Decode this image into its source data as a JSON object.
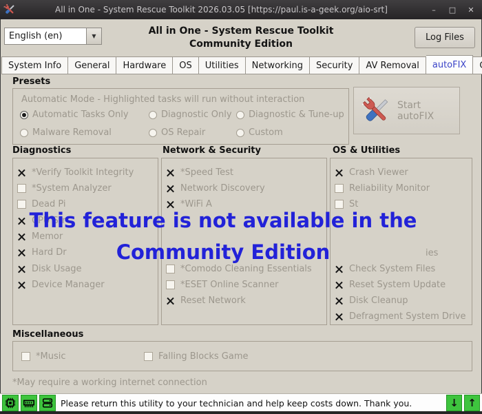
{
  "window": {
    "title": "All in One - System Rescue Toolkit 2026.03.05 [https://paul.is-a-geek.org/aio-srt]",
    "controls": {
      "minimize": "–",
      "maximize": "□",
      "close": "✕"
    }
  },
  "header": {
    "language_selected": "English (en)",
    "title_line1": "All in One - System Rescue Toolkit",
    "title_line2": "Community Edition",
    "log_files_button": "Log Files"
  },
  "tabs": {
    "active": "autoFIX",
    "items": [
      {
        "label": "System Info"
      },
      {
        "label": "General"
      },
      {
        "label": "Hardware"
      },
      {
        "label": "OS"
      },
      {
        "label": "Utilities"
      },
      {
        "label": "Networking"
      },
      {
        "label": "Security"
      },
      {
        "label": "AV Removal"
      },
      {
        "label": "autoFIX"
      },
      {
        "label": "Customize"
      }
    ]
  },
  "presets": {
    "heading": "Presets",
    "mode_text": "Automatic Mode - Highlighted tasks will run without interaction",
    "options": [
      {
        "label": "Automatic Tasks Only",
        "selected": true
      },
      {
        "label": "Diagnostic Only",
        "selected": false
      },
      {
        "label": "Diagnostic & Tune-up",
        "selected": false
      },
      {
        "label": "Malware Removal",
        "selected": false
      },
      {
        "label": "OS Repair",
        "selected": false
      },
      {
        "label": "Custom",
        "selected": false
      }
    ],
    "start_button": "Start autoFIX"
  },
  "columns": [
    {
      "title": "Diagnostics",
      "items": [
        {
          "checked": true,
          "label": "*Verify Toolkit Integrity"
        },
        {
          "checked": false,
          "label": "*System Analyzer"
        },
        {
          "checked": false,
          "label": "Dead Pi"
        },
        {
          "checked": true,
          "label": "CPU Str"
        },
        {
          "checked": true,
          "label": "Memor"
        },
        {
          "checked": true,
          "label": "Hard Dr"
        },
        {
          "checked": true,
          "label": "Disk Usage"
        },
        {
          "checked": true,
          "label": "Device Manager"
        }
      ]
    },
    {
      "title": "Network & Security",
      "items": [
        {
          "checked": true,
          "label": "*Speed Test"
        },
        {
          "checked": true,
          "label": "Network Discovery"
        },
        {
          "checked": true,
          "label": "*WiFi A"
        },
        {
          "checked": false,
          "label": "*Comodo Cleaning Essentials"
        },
        {
          "checked": false,
          "label": "*ESET Online Scanner"
        },
        {
          "checked": true,
          "label": "Reset Network"
        }
      ]
    },
    {
      "title": "OS & Utilities",
      "items": [
        {
          "checked": true,
          "label": "Crash Viewer"
        },
        {
          "checked": false,
          "label": "Reliability Monitor"
        },
        {
          "checked": false,
          "label": "St"
        },
        {
          "label": "ies"
        },
        {
          "checked": true,
          "label": "Check System Files"
        },
        {
          "checked": true,
          "label": "Reset System Update"
        },
        {
          "checked": true,
          "label": "Disk Cleanup"
        },
        {
          "checked": true,
          "label": "Defragment System Drive"
        }
      ]
    }
  ],
  "overlay": {
    "line1": "This feature is not available in the",
    "line2": "Community Edition",
    "color": "#2222d8"
  },
  "miscellaneous": {
    "heading": "Miscellaneous",
    "items": [
      {
        "checked": false,
        "label": "*Music"
      },
      {
        "checked": false,
        "label": "Falling Blocks Game"
      }
    ]
  },
  "footnote": "*May require a working internet connection",
  "statusbar": {
    "message": "Please return this utility to your technician and help keep costs down. Thank you.",
    "icon_color": "#3ec43e",
    "arrows": {
      "down": "↓",
      "up": "↑"
    }
  }
}
